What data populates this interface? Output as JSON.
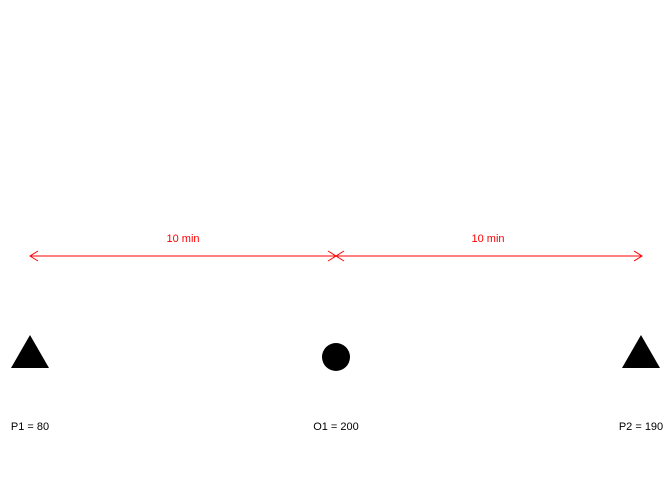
{
  "colors": {
    "background": "#ffffff",
    "distance": "#ff0000",
    "node": "#000000"
  },
  "distances": [
    {
      "label": "10 min",
      "from": "P1",
      "to": "O1"
    },
    {
      "label": "10 min",
      "from": "O1",
      "to": "P2"
    }
  ],
  "nodes": [
    {
      "id": "P1",
      "shape": "triangle",
      "label": "P1 = 80"
    },
    {
      "id": "O1",
      "shape": "circle",
      "label": "O1 = 200"
    },
    {
      "id": "P2",
      "shape": "triangle",
      "label": "P2 = 190"
    }
  ]
}
